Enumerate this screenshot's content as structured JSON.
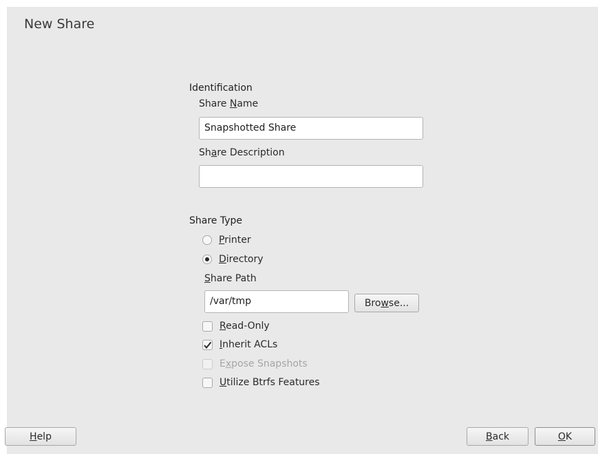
{
  "header": {
    "title": "New Share"
  },
  "identification": {
    "title": "Identification",
    "share_name": {
      "label_pre": "Share ",
      "label_key": "N",
      "label_post": "ame",
      "value": "Snapshotted Share"
    },
    "share_description": {
      "label_pre": "Sh",
      "label_key": "a",
      "label_post": "re Description",
      "value": ""
    }
  },
  "share_type": {
    "title": "Share Type",
    "options": [
      {
        "key": "P",
        "rest": "rinter",
        "selected": false
      },
      {
        "key": "D",
        "rest": "irectory",
        "selected": true
      }
    ],
    "share_path": {
      "label_key": "S",
      "label_rest": "hare Path",
      "value": "/var/tmp"
    },
    "browse": {
      "pre": "Bro",
      "key": "w",
      "post": "se..."
    }
  },
  "checkboxes": [
    {
      "pre": "",
      "key": "R",
      "post": "ead-Only",
      "checked": false,
      "disabled": false
    },
    {
      "pre": "",
      "key": "I",
      "post": "nherit ACLs",
      "checked": true,
      "disabled": false
    },
    {
      "pre": "E",
      "key": "x",
      "post": "pose Snapshots",
      "checked": false,
      "disabled": true
    },
    {
      "pre": "",
      "key": "U",
      "post": "tilize Btrfs Features",
      "checked": false,
      "disabled": false
    }
  ],
  "footer": {
    "help": {
      "key": "H",
      "rest": "elp"
    },
    "back": {
      "key": "B",
      "rest": "ack"
    },
    "ok": {
      "key": "O",
      "rest": "K"
    }
  },
  "colors": {
    "background": "#e9e9e9",
    "input_border": "#b4b4b4",
    "disabled_text": "#a6a6a6"
  }
}
